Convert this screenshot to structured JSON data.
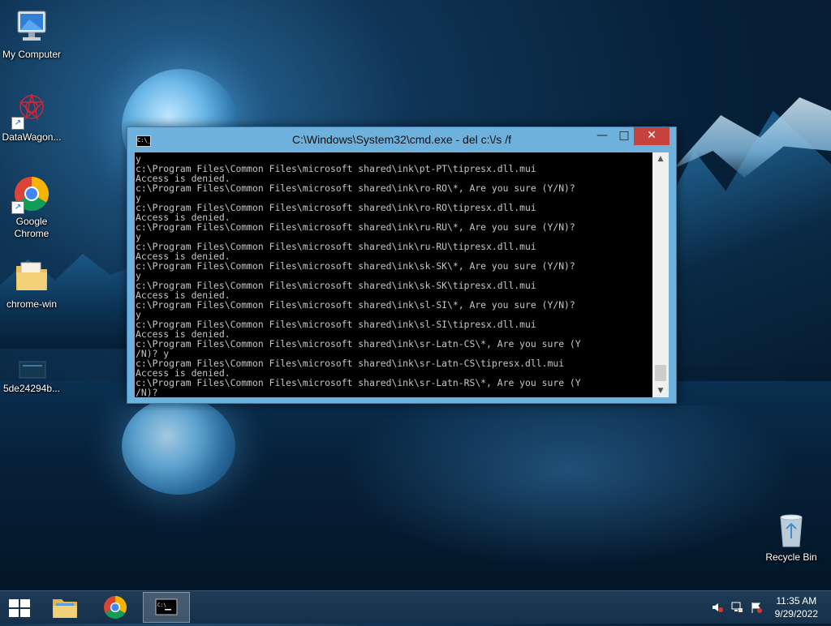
{
  "desktop": {
    "icons": [
      {
        "label": "My Computer",
        "icon": "computer-icon"
      },
      {
        "label": "DataWagon...",
        "icon": "datawagon-icon"
      },
      {
        "label": "Google Chrome",
        "icon": "chrome-icon"
      },
      {
        "label": "chrome-win",
        "icon": "folder-icon"
      },
      {
        "label": "5de24294b...",
        "icon": "file-icon"
      },
      {
        "label": "Recycle Bin",
        "icon": "recycle-bin-icon"
      }
    ]
  },
  "window": {
    "title": "C:\\Windows\\System32\\cmd.exe - del  c:\\/s /f",
    "minimize_label": "—",
    "maximize_label": "□",
    "close_label": "✕",
    "console_text": "y\nc:\\Program Files\\Common Files\\microsoft shared\\ink\\pt-PT\\tipresx.dll.mui\nAccess is denied.\nc:\\Program Files\\Common Files\\microsoft shared\\ink\\ro-RO\\*, Are you sure (Y/N)?\ny\nc:\\Program Files\\Common Files\\microsoft shared\\ink\\ro-RO\\tipresx.dll.mui\nAccess is denied.\nc:\\Program Files\\Common Files\\microsoft shared\\ink\\ru-RU\\*, Are you sure (Y/N)?\ny\nc:\\Program Files\\Common Files\\microsoft shared\\ink\\ru-RU\\tipresx.dll.mui\nAccess is denied.\nc:\\Program Files\\Common Files\\microsoft shared\\ink\\sk-SK\\*, Are you sure (Y/N)?\ny\nc:\\Program Files\\Common Files\\microsoft shared\\ink\\sk-SK\\tipresx.dll.mui\nAccess is denied.\nc:\\Program Files\\Common Files\\microsoft shared\\ink\\sl-SI\\*, Are you sure (Y/N)?\ny\nc:\\Program Files\\Common Files\\microsoft shared\\ink\\sl-SI\\tipresx.dll.mui\nAccess is denied.\nc:\\Program Files\\Common Files\\microsoft shared\\ink\\sr-Latn-CS\\*, Are you sure (Y\n/N)? y\nc:\\Program Files\\Common Files\\microsoft shared\\ink\\sr-Latn-CS\\tipresx.dll.mui\nAccess is denied.\nc:\\Program Files\\Common Files\\microsoft shared\\ink\\sr-Latn-RS\\*, Are you sure (Y\n/N)?"
  },
  "taskbar": {
    "items": [
      "start-button",
      "file-explorer",
      "google-chrome",
      "command-prompt"
    ],
    "tray": {
      "time": "11:35 AM",
      "date": "9/29/2022"
    }
  },
  "colors": {
    "title_bar": "#6fb1dd",
    "close_button": "#c7433e",
    "console_bg": "#000000",
    "console_fg": "#c6c6c6",
    "taskbar": "#15304a"
  }
}
